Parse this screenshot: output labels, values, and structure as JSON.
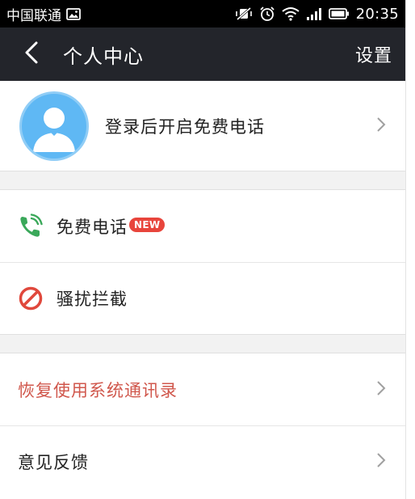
{
  "status_bar": {
    "carrier": "中国联通",
    "time": "20:35"
  },
  "nav": {
    "title": "个人中心",
    "settings_label": "设置"
  },
  "profile": {
    "login_prompt": "登录后开启免费电话"
  },
  "features": {
    "free_call_label": "免费电话",
    "free_call_badge": "NEW",
    "block_label": "骚扰拦截"
  },
  "options": {
    "restore_contacts_label": "恢复使用系统通讯录",
    "feedback_label": "意见反馈"
  },
  "colors": {
    "nav_background": "#23252b",
    "accent_text": "#d0574c",
    "badge": "#e8453c",
    "call_icon": "#3aa85a",
    "block_icon": "#e0483c",
    "avatar": "#5fb8f4"
  },
  "icons": {
    "back": "chevron-left-icon",
    "avatar": "person-silhouette-icon",
    "free_call": "phone-ringing-icon",
    "block": "no-entry-icon",
    "row_arrow": "chevron-right-icon"
  }
}
